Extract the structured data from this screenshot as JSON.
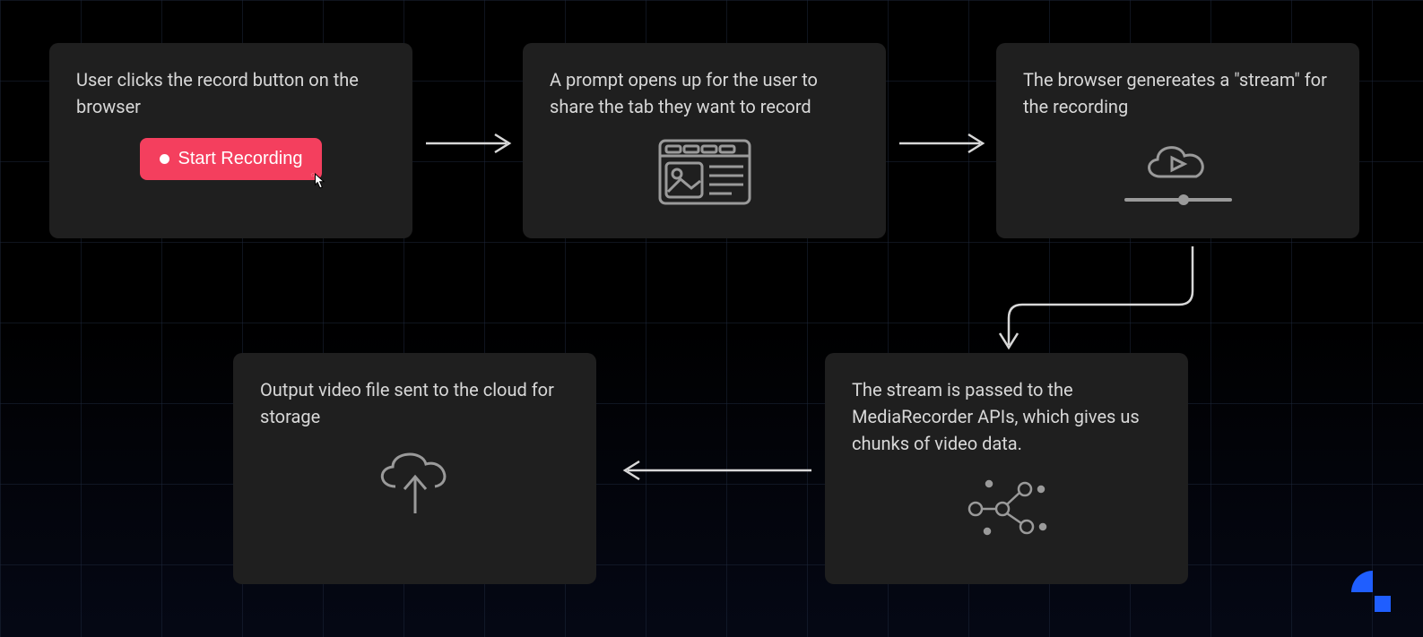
{
  "steps": {
    "s1": {
      "text": "User clicks the record button on the browser",
      "button_label": "Start Recording"
    },
    "s2": {
      "text": "A prompt opens up for the user to share the tab they want to record"
    },
    "s3": {
      "text": "The browser genereates a \"stream\" for the recording"
    },
    "s4": {
      "text": "The stream is passed to the MediaRecorder APIs, which gives us chunks of video data."
    },
    "s5": {
      "text": "Output video file sent to the cloud for storage"
    }
  },
  "colors": {
    "accent": "#f43f5e",
    "logo": "#1f5eff"
  }
}
